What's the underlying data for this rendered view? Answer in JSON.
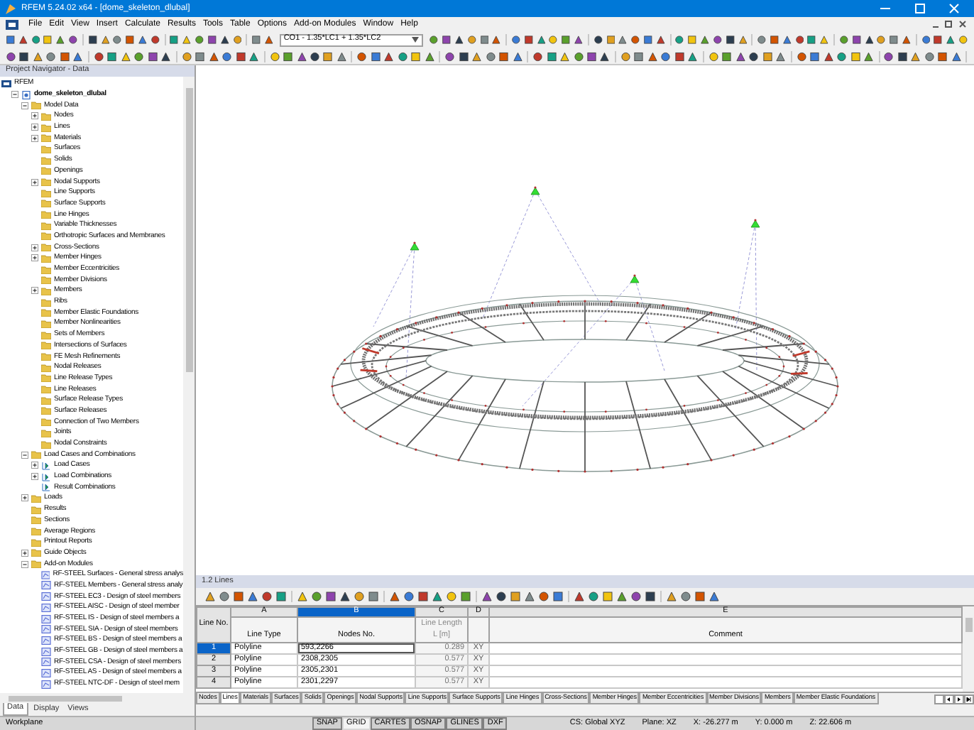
{
  "window": {
    "title": "RFEM 5.24.02 x64 - [dome_skeleton_dlubal]"
  },
  "menu": [
    "File",
    "Edit",
    "View",
    "Insert",
    "Calculate",
    "Results",
    "Tools",
    "Table",
    "Options",
    "Add-on Modules",
    "Window",
    "Help"
  ],
  "toolbar": {
    "load_combo": "CO1 - 1.35*LC1 + 1.35*LC2"
  },
  "navigator": {
    "title": "Project Navigator - Data",
    "tree": [
      {
        "label": "RFEM",
        "kind": "root",
        "children": [
          {
            "label": "dome_skeleton_dlubal",
            "kind": "project",
            "expanded": true,
            "children": [
              {
                "label": "Model Data",
                "kind": "folder",
                "expanded": true,
                "children": [
                  {
                    "label": "Nodes",
                    "kind": "folder",
                    "expanded": false
                  },
                  {
                    "label": "Lines",
                    "kind": "folder",
                    "expanded": false
                  },
                  {
                    "label": "Materials",
                    "kind": "folder",
                    "expanded": false
                  },
                  {
                    "label": "Surfaces",
                    "kind": "folder"
                  },
                  {
                    "label": "Solids",
                    "kind": "folder"
                  },
                  {
                    "label": "Openings",
                    "kind": "folder"
                  },
                  {
                    "label": "Nodal Supports",
                    "kind": "folder",
                    "expanded": false
                  },
                  {
                    "label": "Line Supports",
                    "kind": "folder"
                  },
                  {
                    "label": "Surface Supports",
                    "kind": "folder"
                  },
                  {
                    "label": "Line Hinges",
                    "kind": "folder"
                  },
                  {
                    "label": "Variable Thicknesses",
                    "kind": "folder"
                  },
                  {
                    "label": "Orthotropic Surfaces and Membranes",
                    "kind": "folder"
                  },
                  {
                    "label": "Cross-Sections",
                    "kind": "folder",
                    "expanded": false
                  },
                  {
                    "label": "Member Hinges",
                    "kind": "folder",
                    "expanded": false
                  },
                  {
                    "label": "Member Eccentricities",
                    "kind": "folder"
                  },
                  {
                    "label": "Member Divisions",
                    "kind": "folder"
                  },
                  {
                    "label": "Members",
                    "kind": "folder",
                    "expanded": false
                  },
                  {
                    "label": "Ribs",
                    "kind": "folder"
                  },
                  {
                    "label": "Member Elastic Foundations",
                    "kind": "folder"
                  },
                  {
                    "label": "Member Nonlinearities",
                    "kind": "folder"
                  },
                  {
                    "label": "Sets of Members",
                    "kind": "folder"
                  },
                  {
                    "label": "Intersections of Surfaces",
                    "kind": "folder"
                  },
                  {
                    "label": "FE Mesh Refinements",
                    "kind": "folder"
                  },
                  {
                    "label": "Nodal Releases",
                    "kind": "folder"
                  },
                  {
                    "label": "Line Release Types",
                    "kind": "folder"
                  },
                  {
                    "label": "Line Releases",
                    "kind": "folder"
                  },
                  {
                    "label": "Surface Release Types",
                    "kind": "folder"
                  },
                  {
                    "label": "Surface Releases",
                    "kind": "folder"
                  },
                  {
                    "label": "Connection of Two Members",
                    "kind": "folder"
                  },
                  {
                    "label": "Joints",
                    "kind": "folder"
                  },
                  {
                    "label": "Nodal Constraints",
                    "kind": "folder"
                  }
                ]
              },
              {
                "label": "Load Cases and Combinations",
                "kind": "folder",
                "expanded": true,
                "children": [
                  {
                    "label": "Load Cases",
                    "kind": "load",
                    "expanded": false
                  },
                  {
                    "label": "Load Combinations",
                    "kind": "load",
                    "expanded": false
                  },
                  {
                    "label": "Result Combinations",
                    "kind": "load"
                  }
                ]
              },
              {
                "label": "Loads",
                "kind": "folder",
                "expanded": false
              },
              {
                "label": "Results",
                "kind": "folder"
              },
              {
                "label": "Sections",
                "kind": "folder"
              },
              {
                "label": "Average Regions",
                "kind": "folder"
              },
              {
                "label": "Printout Reports",
                "kind": "folder"
              },
              {
                "label": "Guide Objects",
                "kind": "folder",
                "expanded": false
              },
              {
                "label": "Add-on Modules",
                "kind": "folder",
                "expanded": true,
                "children": [
                  {
                    "label": "RF-STEEL Surfaces - General stress analys",
                    "kind": "module"
                  },
                  {
                    "label": "RF-STEEL Members - General stress analy",
                    "kind": "module"
                  },
                  {
                    "label": "RF-STEEL EC3 - Design of steel members",
                    "kind": "module"
                  },
                  {
                    "label": "RF-STEEL AISC - Design of steel member",
                    "kind": "module"
                  },
                  {
                    "label": "RF-STEEL IS - Design of steel members a",
                    "kind": "module"
                  },
                  {
                    "label": "RF-STEEL SIA - Design of steel members",
                    "kind": "module"
                  },
                  {
                    "label": "RF-STEEL BS - Design of steel members a",
                    "kind": "module"
                  },
                  {
                    "label": "RF-STEEL GB - Design of steel members a",
                    "kind": "module"
                  },
                  {
                    "label": "RF-STEEL CSA - Design of steel members",
                    "kind": "module"
                  },
                  {
                    "label": "RF-STEEL AS - Design of steel members a",
                    "kind": "module"
                  },
                  {
                    "label": "RF-STEEL NTC-DF - Design of steel mem",
                    "kind": "module"
                  }
                ]
              }
            ]
          }
        ]
      }
    ],
    "tabs": [
      {
        "label": "Data",
        "selected": true
      },
      {
        "label": "Display",
        "selected": false
      },
      {
        "label": "Views",
        "selected": false
      }
    ]
  },
  "table_panel": {
    "title": "1.2 Lines",
    "row_header": "Line No.",
    "columns": [
      {
        "letter": "A",
        "label": "Line Type",
        "selected": false
      },
      {
        "letter": "B",
        "label": "Nodes No.",
        "selected": true
      },
      {
        "letter": "C",
        "label": "Line Length",
        "unit": "L [m]",
        "selected": false
      },
      {
        "letter": "D",
        "selected": false
      },
      {
        "letter": "E",
        "label": "Comment",
        "selected": false
      }
    ],
    "rows": [
      {
        "number": "1",
        "selected": true,
        "cells": [
          "Polyline",
          "593,2266",
          "0.289",
          "XY"
        ]
      },
      {
        "number": "2",
        "selected": false,
        "cells": [
          "Polyline",
          "2308,2305",
          "0.577",
          "XY"
        ]
      },
      {
        "number": "3",
        "selected": false,
        "cells": [
          "Polyline",
          "2305,2301",
          "0.577",
          "XY"
        ]
      },
      {
        "number": "4",
        "selected": false,
        "cells": [
          "Polyline",
          "2301,2297",
          "0.577",
          "XY"
        ]
      }
    ],
    "tabs": [
      {
        "label": "Nodes",
        "selected": false
      },
      {
        "label": "Lines",
        "selected": true
      },
      {
        "label": "Materials",
        "selected": false
      },
      {
        "label": "Surfaces",
        "selected": false
      },
      {
        "label": "Solids",
        "selected": false
      },
      {
        "label": "Openings",
        "selected": false
      },
      {
        "label": "Nodal Supports",
        "selected": false
      },
      {
        "label": "Line Supports",
        "selected": false
      },
      {
        "label": "Surface Supports",
        "selected": false
      },
      {
        "label": "Line Hinges",
        "selected": false
      },
      {
        "label": "Cross-Sections",
        "selected": false
      },
      {
        "label": "Member Hinges",
        "selected": false
      },
      {
        "label": "Member Eccentricities",
        "selected": false
      },
      {
        "label": "Member Divisions",
        "selected": false
      },
      {
        "label": "Members",
        "selected": false
      },
      {
        "label": "Member Elastic Foundations",
        "selected": false
      }
    ]
  },
  "status_bar": {
    "workplane": "Workplane",
    "toggles": [
      {
        "label": "SNAP",
        "on": false
      },
      {
        "label": "GRID",
        "on": true
      },
      {
        "label": "CARTES",
        "on": false
      },
      {
        "label": "OSNAP",
        "on": false
      },
      {
        "label": "GLINES",
        "on": false
      },
      {
        "label": "DXF",
        "on": false
      }
    ],
    "readouts": [
      "CS: Global XYZ",
      "Plane: XZ",
      "X: -26.277 m",
      "Y: 0.000 m",
      "Z: 22.606 m"
    ]
  }
}
